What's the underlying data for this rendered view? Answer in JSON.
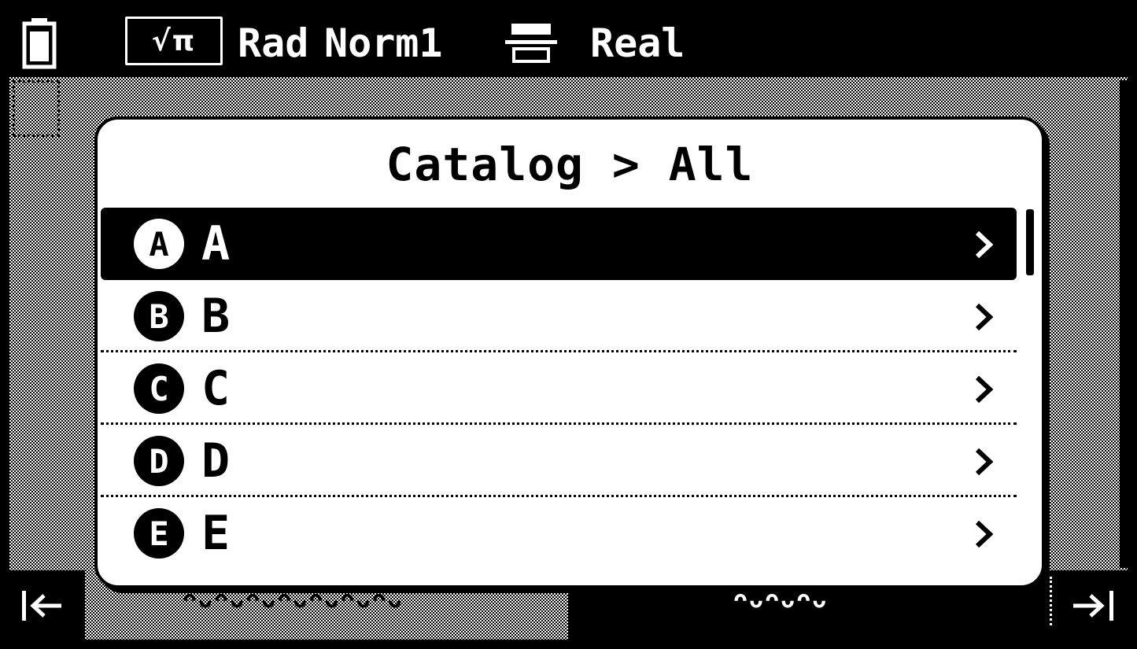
{
  "status_bar": {
    "mode_icon": "sqrt-pi-icon",
    "mode_text": "√π",
    "angle_unit": "Rad",
    "display_format": "Norm1",
    "fraction_icon": "fraction-format-icon",
    "number_domain": "Real"
  },
  "dialog": {
    "title": "Catalog > All",
    "items": [
      {
        "badge": "A",
        "label": "A",
        "selected": true
      },
      {
        "badge": "B",
        "label": "B",
        "selected": false
      },
      {
        "badge": "C",
        "label": "C",
        "selected": false
      },
      {
        "badge": "D",
        "label": "D",
        "selected": false
      },
      {
        "badge": "E",
        "label": "E",
        "selected": false
      }
    ]
  },
  "soft_keys": {
    "left_icon": "scroll-left-icon",
    "left_label": "ᴖᴗᴖᴗᴖᴗᴖᴗᴖᴗᴖᴗᴖᴗ",
    "right_label": "ᴖᴗᴖᴗᴖᴗ",
    "right_icon": "scroll-right-icon"
  },
  "colors": {
    "foreground": "#000000",
    "background": "#ffffff"
  }
}
